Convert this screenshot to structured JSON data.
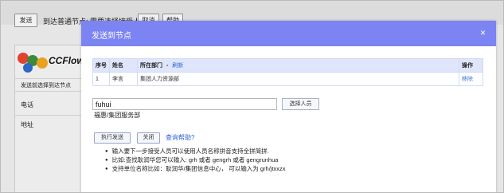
{
  "background": {
    "send_button": "发送",
    "node_text": "到达普通节点: 需要选择接受人",
    "button2": "取消",
    "button3": "帮助",
    "logo_text": "CCFlow",
    "panel_title": "发送前选择到达节点",
    "rows": [
      "电话",
      "地址"
    ]
  },
  "modal": {
    "title": "发送到节点",
    "close_icon": "×",
    "table": {
      "headers": {
        "seq": "序号",
        "name": "姓名",
        "dept": "所在部门",
        "dash": "-",
        "refresh": "刷新",
        "op": "操作"
      },
      "rows": [
        {
          "seq": "1",
          "name": "李言",
          "dept": "集团人力资源部",
          "action": "移除"
        }
      ]
    },
    "search": {
      "value": "fuhui",
      "select_button": "选择人员",
      "suggestion": "福惠/集团服务部"
    },
    "actions": {
      "execute": "执行发送",
      "close": "关闭",
      "help": "查询帮助?"
    },
    "tips": [
      "输入要下一步接受人员可以使用人员名称拼音支持全拼简拼.",
      "比如:查找耿润华您可以输入: grh 或者 gengrh 或者 gengrunhua",
      "支持单位名称比如：耿润华/集团信息中心， 可以输入为 grh/jtxxzx"
    ]
  },
  "colors": {
    "header": "#7c83f2",
    "link": "#2b62d9",
    "table_head": "#dfe6fb"
  }
}
